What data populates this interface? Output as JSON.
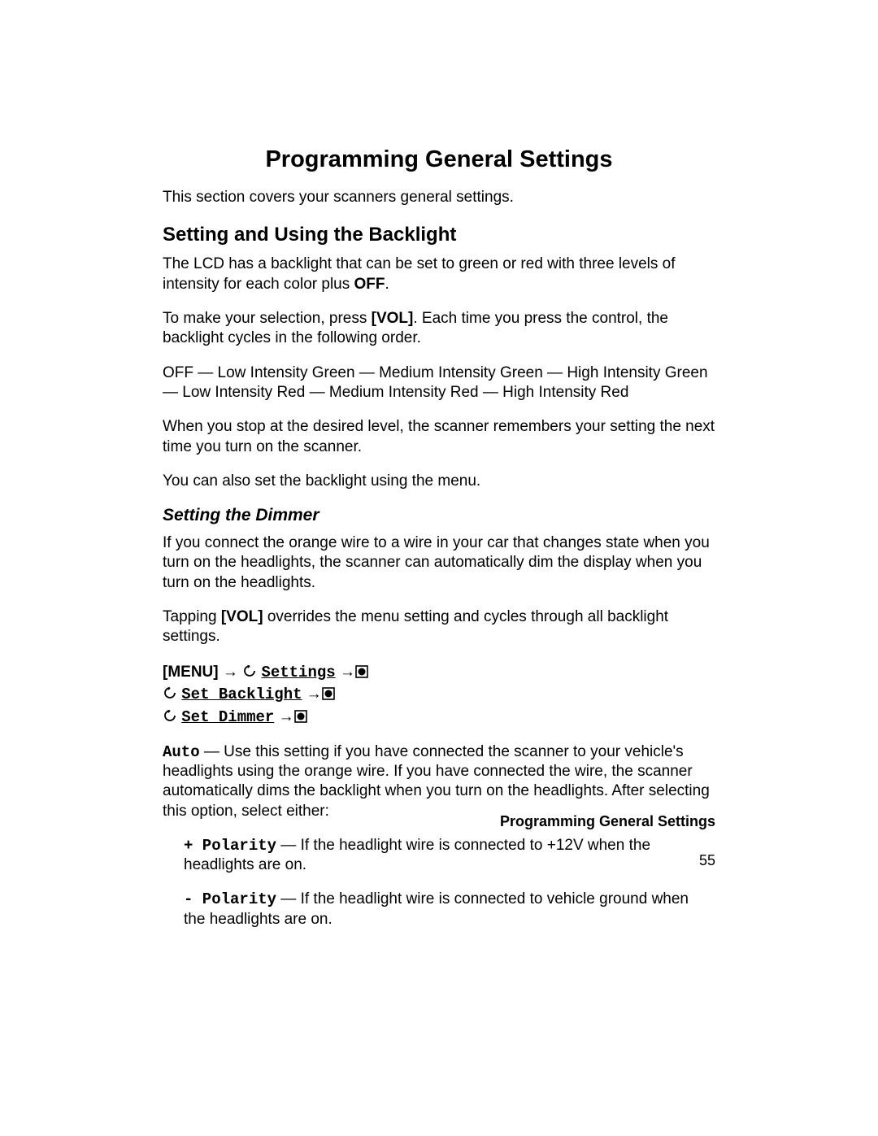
{
  "title": "Programming General Settings",
  "intro": "This section covers your scanners general settings.",
  "s1": {
    "heading": "Setting and Using the Backlight",
    "p1a": "The LCD has a backlight that can be set to green or red with three levels of intensity for each color plus ",
    "p1b_bold": "OFF",
    "p1c": ".",
    "p2a": "To make your selection, press ",
    "p2b_bold": "[VOL]",
    "p2c": ". Each time you press the control, the backlight cycles in the following order.",
    "p3": "OFF — Low Intensity Green — Medium Intensity Green — High Intensity Green — Low Intensity Red  — Medium Intensity Red — High Intensity Red",
    "p4": "When you stop at the desired level, the scanner remembers your setting the next time you turn on the scanner.",
    "p5": "You can also set the backlight using the menu."
  },
  "s2": {
    "heading": "Setting the Dimmer",
    "p1": "If you connect the orange wire to a wire in your car that changes state when you turn on the headlights, the scanner can automatically dim the display when you turn on the headlights.",
    "p2a": "Tapping ",
    "p2b_bold": "[VOL]",
    "p2c": " overrides the menu setting and cycles through all backlight settings.",
    "menu": {
      "l1_label": "[MENU]",
      "l1_opt": "Settings",
      "l2_opt": "Set Backlight",
      "l3_opt": "Set Dimmer"
    },
    "auto_label": "Auto",
    "auto_text": " — Use this setting if you have connected the scanner to your vehicle's headlights using the orange wire. If you have connected the wire, the scanner automatically dims the backlight when you turn on the headlights. After selecting this option, select either:",
    "pos_label": "+ Polarity",
    "pos_text": " — If the headlight wire is connected to +12V when the headlights are on.",
    "neg_label": "- Polarity",
    "neg_text": " — If the headlight wire is connected to vehicle ground when the headlights are on."
  },
  "footer": {
    "section": "Programming General Settings",
    "page": "55"
  },
  "glyph": {
    "arrow": "→"
  }
}
